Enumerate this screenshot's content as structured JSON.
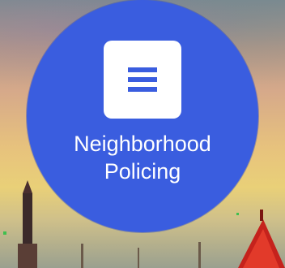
{
  "tile": {
    "label_line1": "Neighborhood",
    "label_line2": "Policing",
    "icon": "menu-lines-icon",
    "color": "#3a5ddf"
  }
}
